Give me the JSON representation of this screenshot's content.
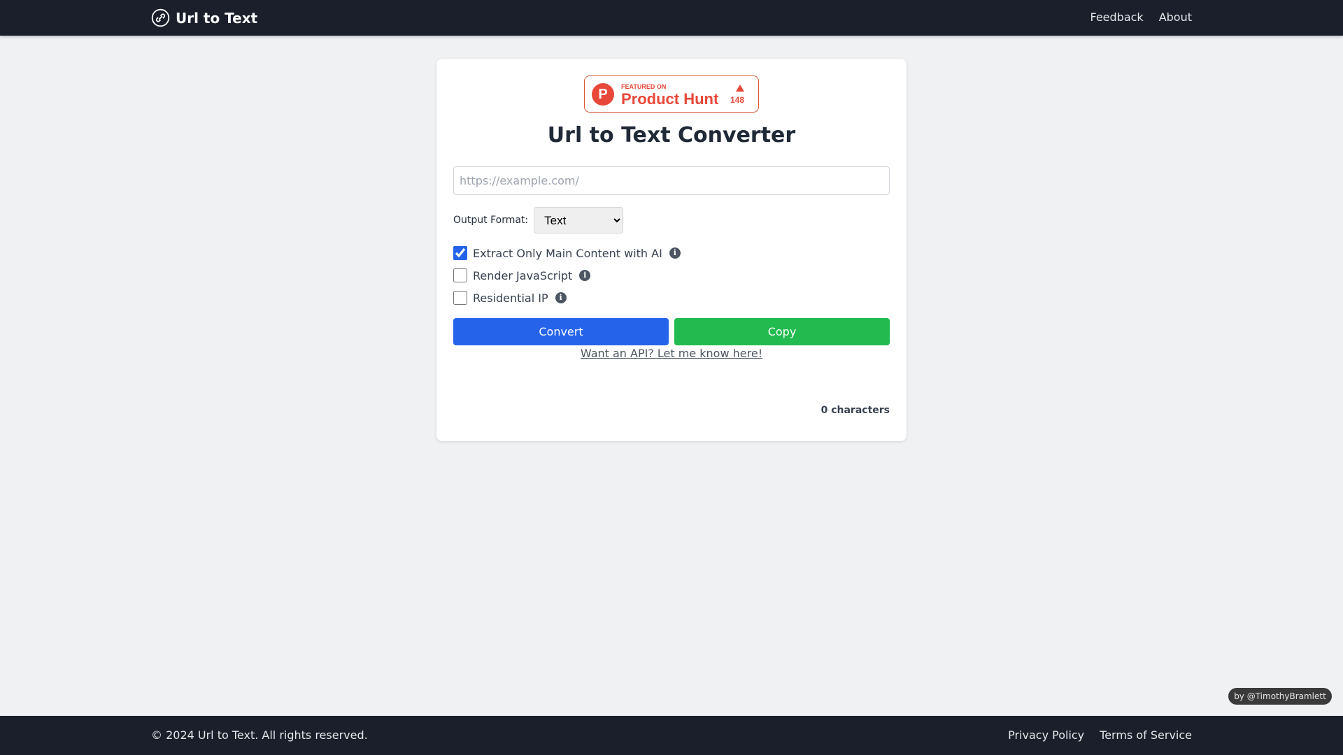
{
  "header": {
    "title": "Url to Text",
    "logo_icon": "link-circle-icon",
    "nav": [
      "Feedback",
      "About"
    ]
  },
  "badge": {
    "featured": "FEATURED ON",
    "name": "Product Hunt",
    "votes": "148",
    "color": "#e8483a"
  },
  "main": {
    "title": "Url to Text Converter",
    "url_placeholder": "https://example.com/",
    "url_value": "",
    "format_label": "Output Format:",
    "format_selected": "Text",
    "options": [
      {
        "label": "Extract Only Main Content with AI",
        "checked": true
      },
      {
        "label": "Render JavaScript",
        "checked": false
      },
      {
        "label": "Residential IP",
        "checked": false
      }
    ],
    "convert": "Convert",
    "copy": "Copy",
    "api_link": "Want an API? Let me know here!",
    "char_count": "0 characters",
    "colors": {
      "convert": "#2563eb",
      "copy": "#22bb4f"
    }
  },
  "credit": "by @TimothyBramlett",
  "footer": {
    "copyright": "© 2024 Url to Text. All rights reserved.",
    "links": [
      "Privacy Policy",
      "Terms of Service"
    ]
  }
}
